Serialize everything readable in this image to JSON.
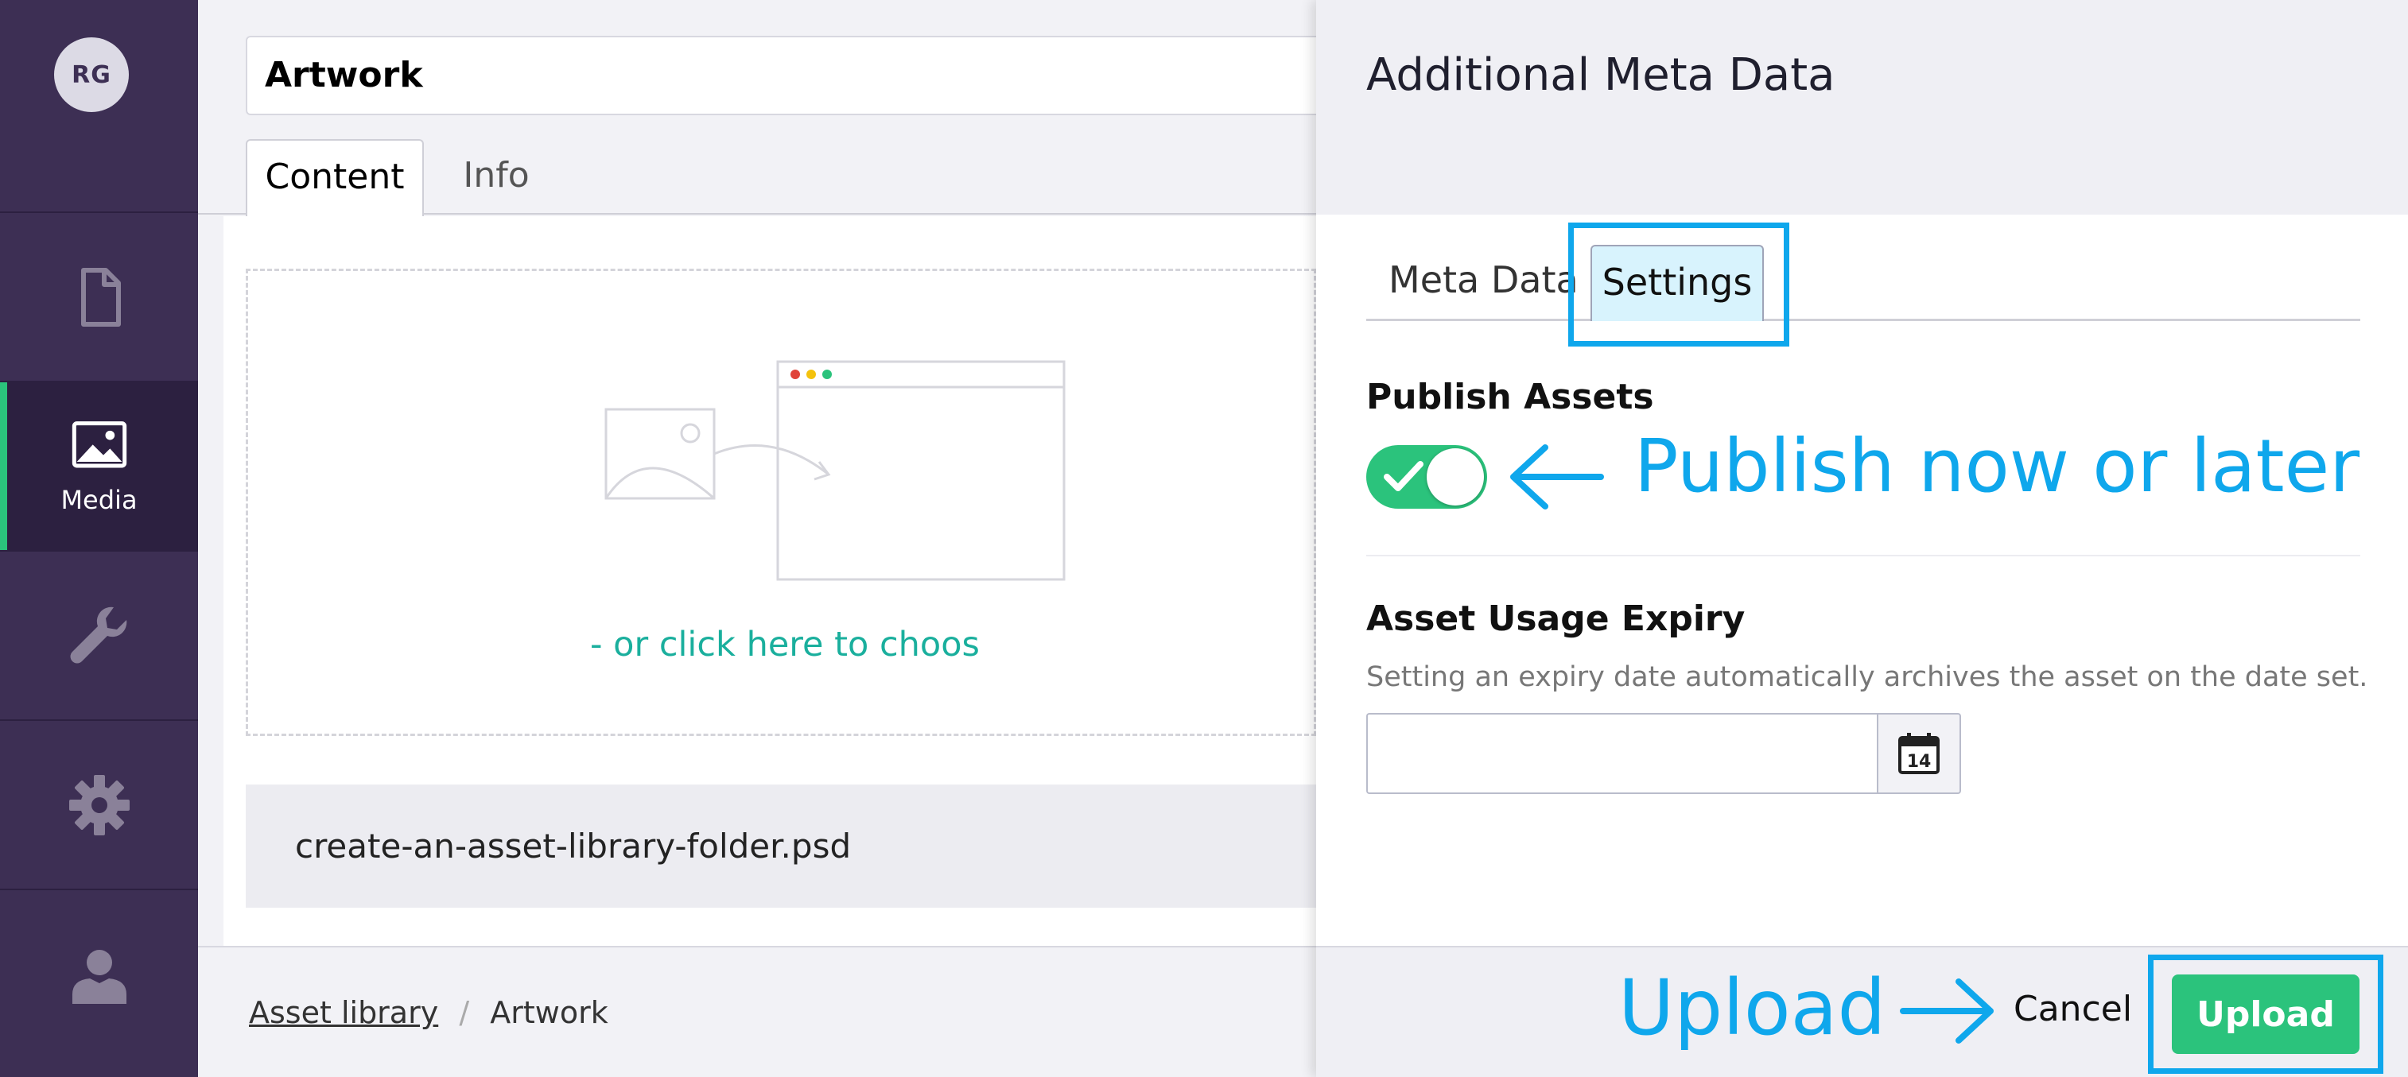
{
  "sidebar": {
    "avatar_initials": "RG",
    "items": [
      {
        "id": "content",
        "label": "",
        "icon": "document-icon"
      },
      {
        "id": "media",
        "label": "Media",
        "icon": "image-icon",
        "active": true
      },
      {
        "id": "settings",
        "label": "",
        "icon": "wrench-icon"
      },
      {
        "id": "packages",
        "label": "",
        "icon": "gear-icon"
      },
      {
        "id": "members",
        "label": "",
        "icon": "user-icon"
      }
    ]
  },
  "editor": {
    "name_value": "Artwork",
    "tabs": [
      {
        "label": "Content",
        "active": true
      },
      {
        "label": "Info",
        "active": false
      }
    ],
    "dropzone_link": "- or click here to choos",
    "file_name": "create-an-asset-library-folder.psd",
    "breadcrumb": [
      {
        "label": "Asset library",
        "link": true
      },
      {
        "label": "Artwork",
        "link": false
      }
    ],
    "breadcrumb_separator": "/"
  },
  "drawer": {
    "title": "Additional Meta Data",
    "tabs": [
      {
        "label": "Meta Data",
        "active": false
      },
      {
        "label": "Settings",
        "active": true
      }
    ],
    "publish": {
      "label": "Publish Assets",
      "enabled": true
    },
    "expiry": {
      "label": "Asset Usage Expiry",
      "help": "Setting an expiry date automatically archives the asset on the date set.",
      "value": "",
      "calendar_day": "14"
    },
    "footer": {
      "cancel_label": "Cancel",
      "upload_label": "Upload"
    }
  },
  "annotations": {
    "publish_note": "Publish now or later",
    "upload_note": "Upload",
    "color": "#0fa7ec"
  },
  "colors": {
    "sidebar_bg": "#3d2f54",
    "accent_green": "#2bc37c",
    "link_teal": "#1aaf9d",
    "annotation_blue": "#0fa7ec"
  }
}
